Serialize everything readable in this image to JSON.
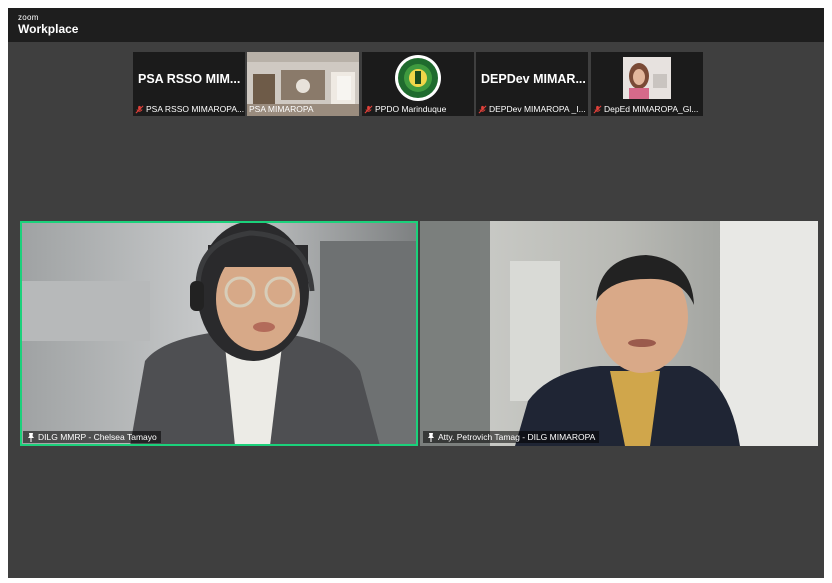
{
  "brand": {
    "small": "zoom",
    "name": "Workplace"
  },
  "gallery": [
    {
      "title": "PSA RSSO MIM...",
      "label": "PSA RSSO MIMAROPA...",
      "muted": true,
      "kind": "name"
    },
    {
      "title": "",
      "label": "PSA MIMAROPA",
      "muted": false,
      "kind": "video"
    },
    {
      "title": "",
      "label": "PPDO Marinduque",
      "muted": true,
      "kind": "logo"
    },
    {
      "title": "DEPDev MIMAR...",
      "label": "DEPDev MIMAROPA _I...",
      "muted": true,
      "kind": "name"
    },
    {
      "title": "",
      "label": "DepEd MIMAROPA_Gl...",
      "muted": true,
      "kind": "video"
    }
  ],
  "main_videos": [
    {
      "label": "DILG MMRP - Chelsea Tamayo",
      "active_speaker": true
    },
    {
      "label": "Atty. Petrovich Tamag - DILG MIMAROPA",
      "active_speaker": false
    }
  ],
  "colors": {
    "app_bg": "#3f3f3f",
    "topbar": "#1e1e1e",
    "tile": "#1b1b1b",
    "active_speaker_border": "#1bd17b",
    "muted_icon": "#e0413a"
  }
}
